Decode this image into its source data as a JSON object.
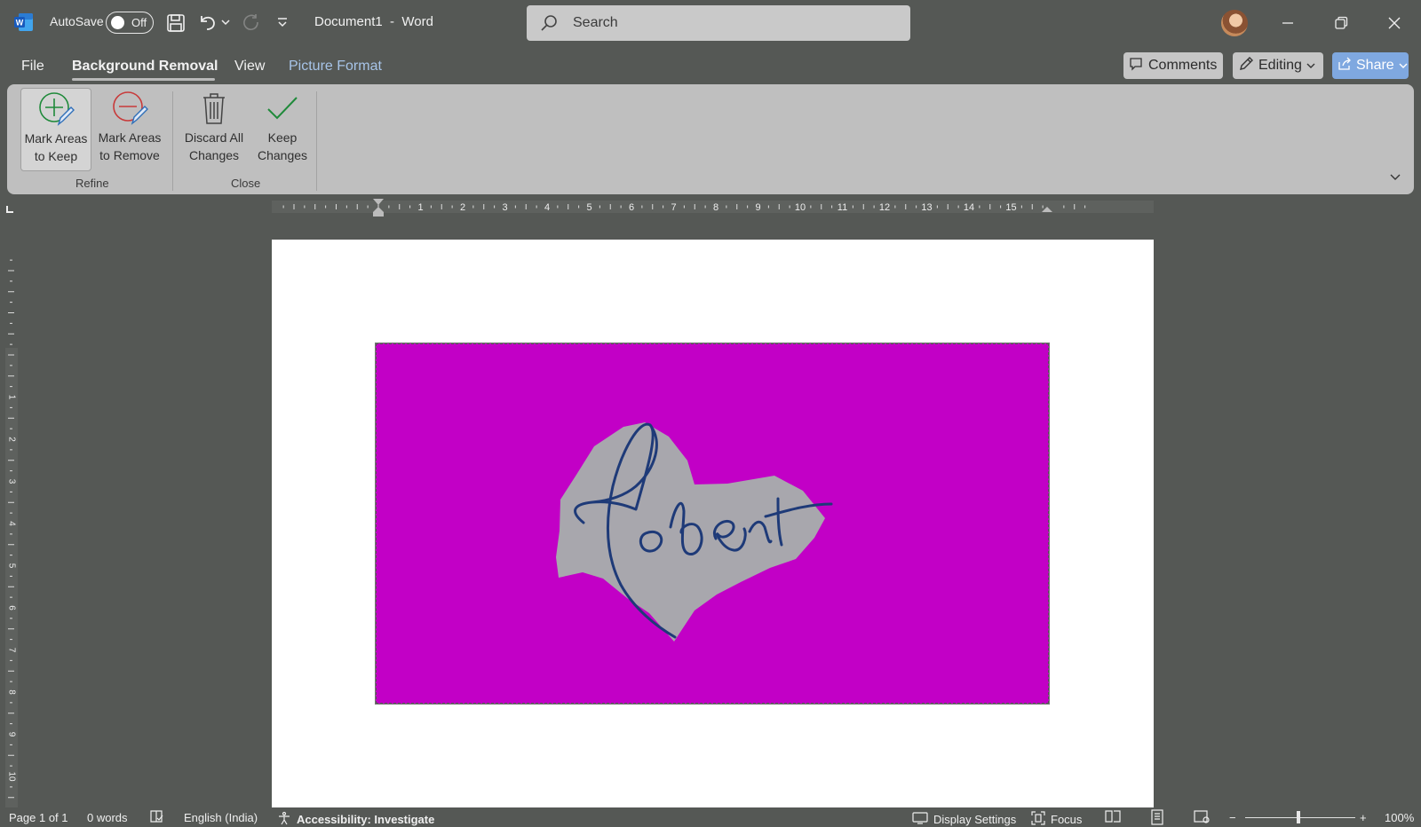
{
  "titlebar": {
    "autosave_label": "AutoSave",
    "autosave_state": "Off",
    "document_title": "Document1  -  Word",
    "search_placeholder": "Search"
  },
  "tabs": {
    "file": "File",
    "background_removal": "Background Removal",
    "view": "View",
    "picture_format": "Picture Format"
  },
  "actions": {
    "comments": "Comments",
    "editing": "Editing",
    "share": "Share"
  },
  "ribbon": {
    "mark_keep_line1": "Mark Areas",
    "mark_keep_line2": "to Keep",
    "mark_remove_line1": "Mark Areas",
    "mark_remove_line2": "to Remove",
    "discard_line1": "Discard All",
    "discard_line2": "Changes",
    "keep_line1": "Keep",
    "keep_line2": "Changes",
    "group_refine": "Refine",
    "group_close": "Close"
  },
  "ruler": {
    "h_numbers": [
      "1",
      "2",
      "3",
      "4",
      "5",
      "6",
      "7",
      "8",
      "9",
      "10",
      "11",
      "12",
      "13",
      "14",
      "15"
    ],
    "v_numbers": [
      "1",
      "2",
      "3",
      "4",
      "5",
      "6",
      "7",
      "8",
      "9",
      "10"
    ]
  },
  "document": {
    "signature_text": "Robert"
  },
  "statusbar": {
    "page": "Page 1 of 1",
    "words": "0 words",
    "language": "English (India)",
    "accessibility": "Accessibility: Investigate",
    "display_settings": "Display Settings",
    "focus": "Focus",
    "zoom_minus": "−",
    "zoom_plus": "+",
    "zoom_percent": "100%",
    "zoom_value": 100
  },
  "colors": {
    "chrome_bg": "#555855",
    "ribbon_bg": "#bfbfbf",
    "removal_magenta": "#c200c6",
    "share_blue": "#7fa8e0",
    "ink_blue": "#1e3a78"
  },
  "icons": [
    "word-logo-icon",
    "save-icon",
    "undo-icon",
    "redo-icon",
    "customize-icon",
    "search-icon",
    "minimize-icon",
    "restore-icon",
    "close-icon",
    "comment-icon",
    "pencil-icon",
    "share-icon",
    "mark-keep-icon",
    "mark-remove-icon",
    "trash-icon",
    "checkmark-icon",
    "chevron-down-icon",
    "proofing-icon",
    "accessibility-icon",
    "display-settings-icon",
    "focus-icon",
    "read-mode-icon",
    "print-layout-icon",
    "web-layout-icon"
  ]
}
